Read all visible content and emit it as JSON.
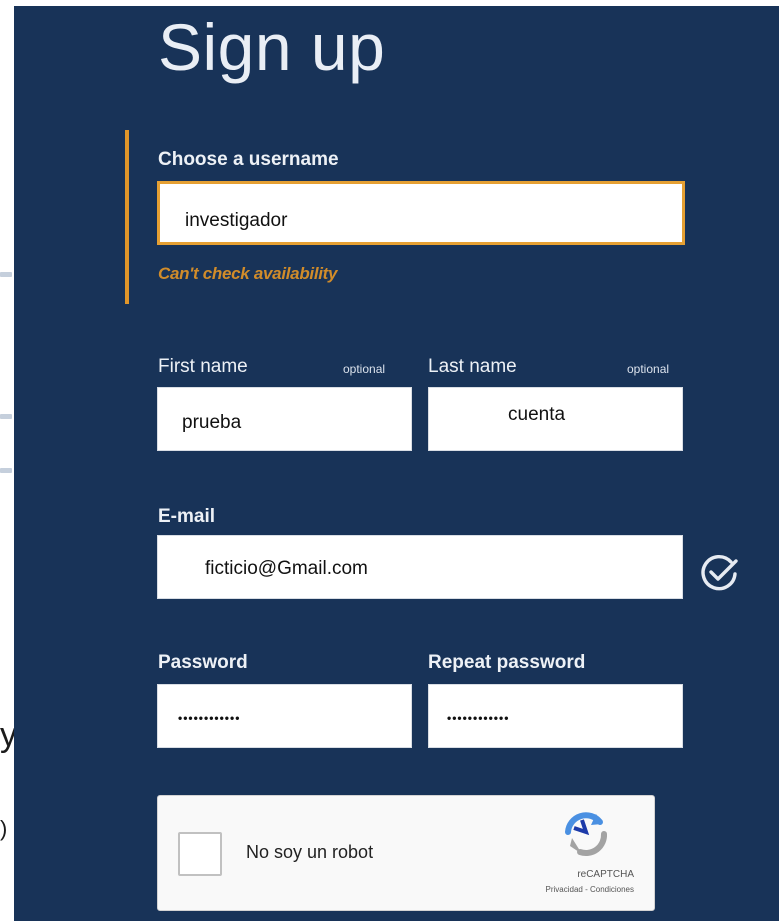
{
  "form": {
    "title": "Sign up",
    "username": {
      "label": "Choose a username",
      "value": "investigador",
      "warning": "Can't check availability"
    },
    "first_name": {
      "label": "First name",
      "optional": "optional",
      "value": "prueba"
    },
    "last_name": {
      "label": "Last name",
      "optional": "optional",
      "value": "cuenta"
    },
    "email": {
      "label": "E-mail",
      "value": "ficticio@Gmail.com",
      "status_icon": "check-circle-icon"
    },
    "password": {
      "label": "Password",
      "value": "••••••••••••"
    },
    "repeat_password": {
      "label": "Repeat password",
      "value": "••••••••••••"
    },
    "captcha": {
      "label": "No soy un robot",
      "brand": "reCAPTCHA",
      "links": "Privacidad - Condiciones",
      "icon": "recaptcha-logo-icon"
    }
  },
  "colors": {
    "panel": "#183358",
    "accent": "#e0962a",
    "text": "#edf1f6"
  }
}
